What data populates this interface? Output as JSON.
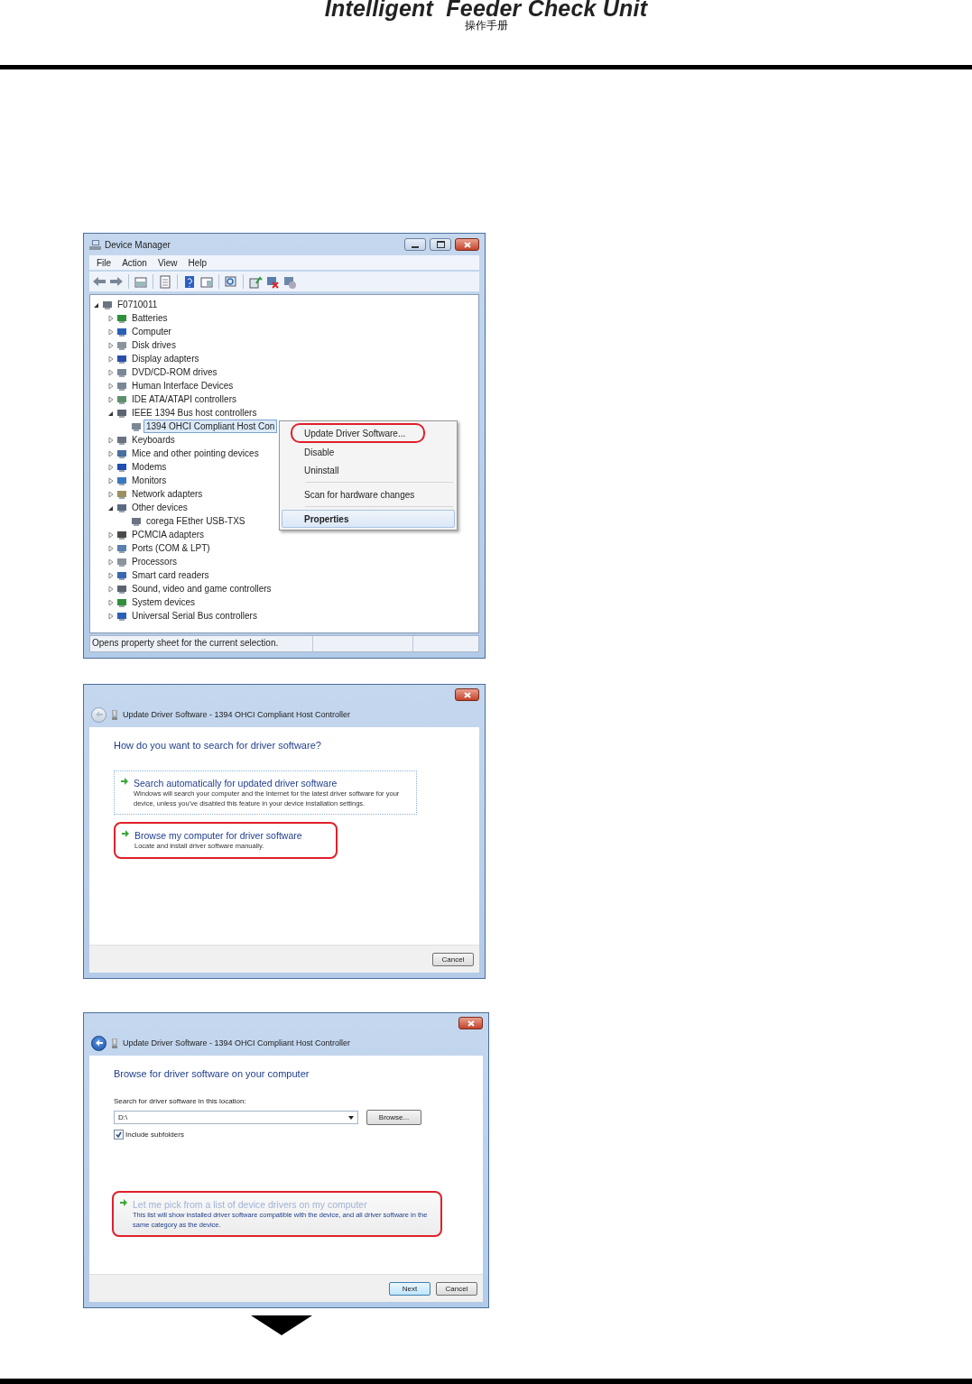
{
  "header": {
    "title": "Intelligent  Feeder Check Unit",
    "subtitle": "操作手册"
  },
  "device_manager": {
    "title": "Device Manager",
    "menu": [
      "File",
      "Action",
      "View",
      "Help"
    ],
    "tree": {
      "label": "F0710011",
      "expanded": true,
      "selected": false,
      "children": [
        {
          "label": "Batteries",
          "expanded": false,
          "selected": false
        },
        {
          "label": "Computer",
          "expanded": false,
          "selected": false
        },
        {
          "label": "Disk drives",
          "expanded": false,
          "selected": false
        },
        {
          "label": "Display adapters",
          "expanded": false,
          "selected": false
        },
        {
          "label": "DVD/CD-ROM drives",
          "expanded": false,
          "selected": false
        },
        {
          "label": "Human Interface Devices",
          "expanded": false,
          "selected": false
        },
        {
          "label": "IDE ATA/ATAPI controllers",
          "expanded": false,
          "selected": false
        },
        {
          "label": "IEEE 1394 Bus host controllers",
          "expanded": true,
          "selected": false,
          "children": [
            {
              "label": "1394 OHCI Compliant Host Con",
              "selected": true
            }
          ]
        },
        {
          "label": "Keyboards",
          "expanded": false,
          "selected": false
        },
        {
          "label": "Mice and other pointing devices",
          "expanded": false,
          "selected": false
        },
        {
          "label": "Modems",
          "expanded": false,
          "selected": false
        },
        {
          "label": "Monitors",
          "expanded": false,
          "selected": false
        },
        {
          "label": "Network adapters",
          "expanded": false,
          "selected": false
        },
        {
          "label": "Other devices",
          "expanded": true,
          "selected": false,
          "children": [
            {
              "label": "corega FEther USB-TXS",
              "selected": false
            }
          ]
        },
        {
          "label": "PCMCIA adapters",
          "expanded": false,
          "selected": false
        },
        {
          "label": "Ports (COM & LPT)",
          "expanded": false,
          "selected": false
        },
        {
          "label": "Processors",
          "expanded": false,
          "selected": false
        },
        {
          "label": "Smart card readers",
          "expanded": false,
          "selected": false
        },
        {
          "label": "Sound, video and game controllers",
          "expanded": false,
          "selected": false
        },
        {
          "label": "System devices",
          "expanded": false,
          "selected": false
        },
        {
          "label": "Universal Serial Bus controllers",
          "expanded": false,
          "selected": false
        }
      ]
    },
    "context_menu": [
      {
        "label": "Update Driver Software...",
        "selected": false,
        "circled": true,
        "divider_after": false
      },
      {
        "label": "Disable",
        "selected": false,
        "circled": false,
        "divider_after": false
      },
      {
        "label": "Uninstall",
        "selected": false,
        "circled": false,
        "divider_after": true
      },
      {
        "label": "Scan for hardware changes",
        "selected": false,
        "circled": false,
        "divider_after": true
      },
      {
        "label": "Properties",
        "selected": true,
        "circled": false,
        "divider_after": false
      }
    ],
    "status_bar": "Opens property sheet for the current selection."
  },
  "dialogs": [
    {
      "title": "Update Driver Software - 1394 OHCI Compliant Host Controller",
      "back_disabled": true,
      "heading": "How do you want to search for driver software?",
      "options": [
        {
          "title": "Search automatically for updated driver software",
          "description": "Windows will search your computer and the Internet for the latest driver software for your device, unless you've disabled this feature in your device installation settings.",
          "focused": true,
          "circled": false,
          "hovered": false
        },
        {
          "title": "Browse my computer for driver software",
          "description": "Locate and install driver software manually.",
          "focused": false,
          "circled": true,
          "hovered": false
        }
      ],
      "buttons": [
        {
          "label": "Cancel",
          "default": false
        }
      ]
    },
    {
      "title": "Update Driver Software - 1394 OHCI Compliant Host Controller",
      "back_disabled": false,
      "heading": "Browse for driver software on your computer",
      "location": {
        "label": "Search for driver software in this location:",
        "value": "D:\\",
        "browse": "Browse...",
        "include_subfolders": {
          "label": "Include subfolders",
          "checked": true
        }
      },
      "options": [
        {
          "title": "Let me pick from a list of device drivers on my computer",
          "description": "This list will show installed driver software compatible with the device, and all driver software in the same category as the device.",
          "focused": false,
          "circled": true,
          "hovered": true
        }
      ],
      "buttons": [
        {
          "label": "Next",
          "default": true
        },
        {
          "label": "Cancel",
          "default": false
        }
      ]
    }
  ]
}
